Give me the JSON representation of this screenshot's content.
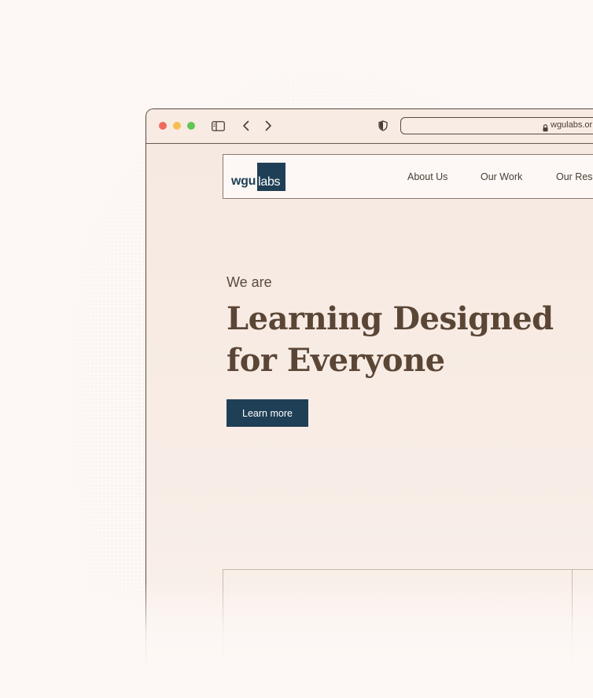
{
  "browser": {
    "url": "wgulabs.or",
    "controls": {
      "sidebar_icon": "sidebar-icon",
      "back_icon": "chevron-left-icon",
      "forward_icon": "chevron-right-icon",
      "privacy_icon": "shield-icon",
      "lock_icon": "lock-icon"
    }
  },
  "site": {
    "logo": {
      "wgu": "wgu",
      "labs": "labs"
    },
    "nav": {
      "items": [
        {
          "label": "About Us"
        },
        {
          "label": "Our Work"
        },
        {
          "label": "Our Rese"
        }
      ]
    },
    "hero": {
      "pre_title": "We are",
      "title": "Learning Designed for Everyone",
      "cta_label": "Learn more"
    }
  },
  "colors": {
    "brand_navy": "#1f3f56",
    "heading_brown": "#5b4636",
    "background": "#fdf8f5",
    "traffic_red": "#ee6a5f",
    "traffic_yellow": "#f5be4f",
    "traffic_green": "#62c655"
  }
}
